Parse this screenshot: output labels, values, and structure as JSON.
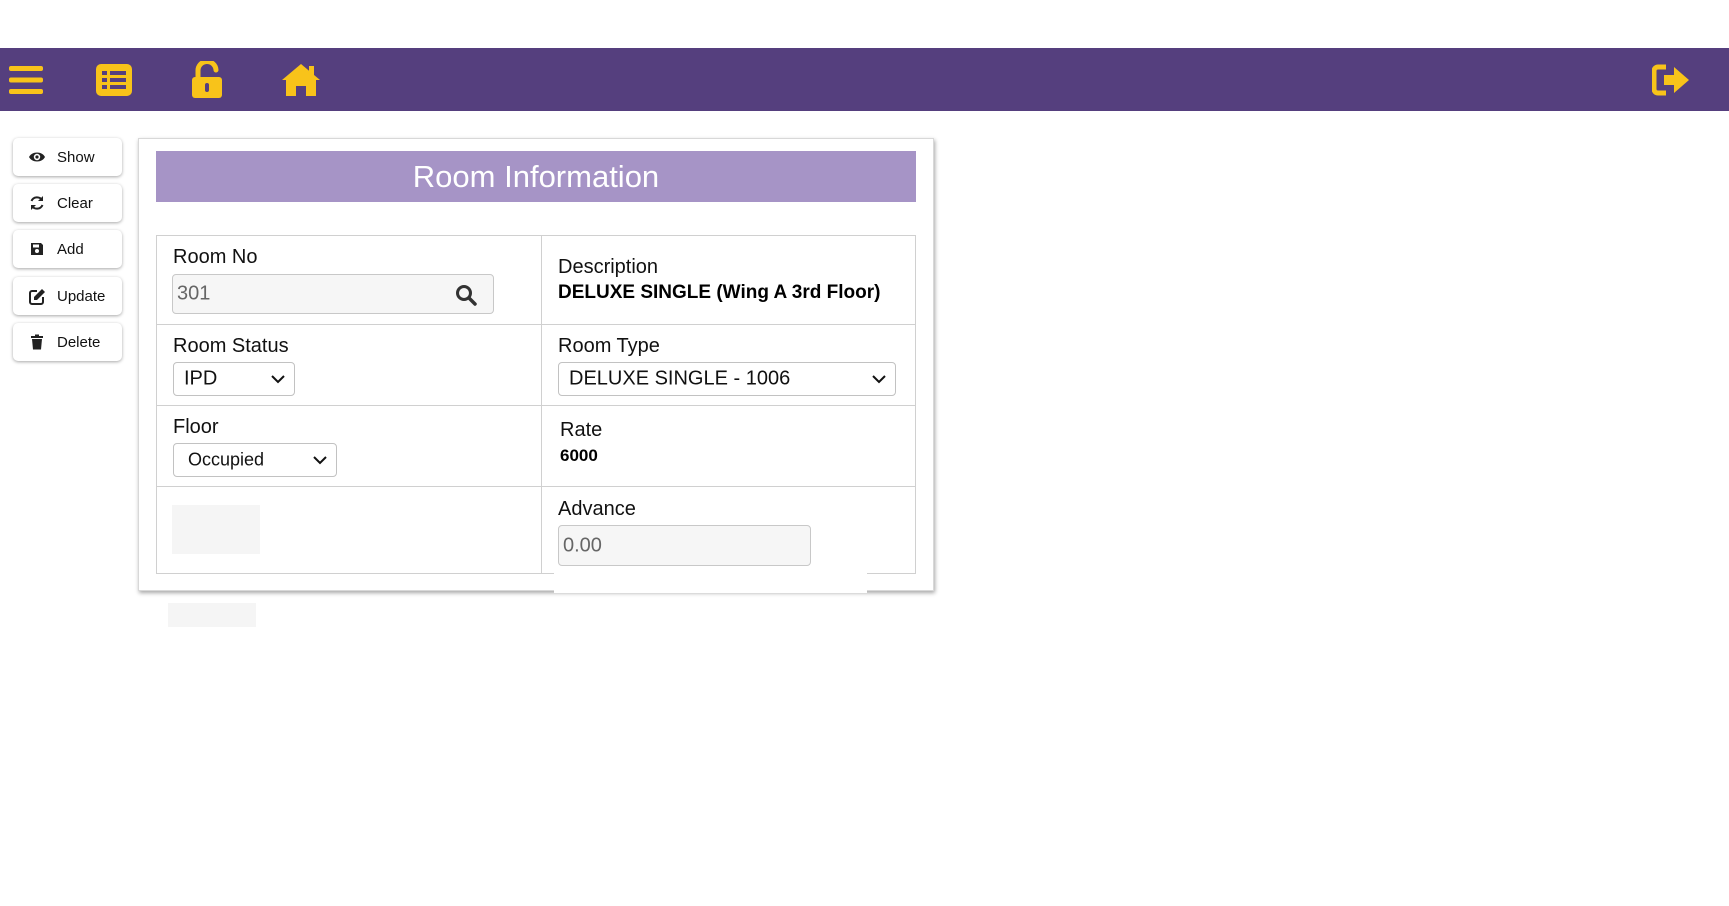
{
  "topbar": {
    "icons": [
      "menu-icon",
      "list-icon",
      "unlock-icon",
      "home-icon",
      "logout-icon"
    ],
    "bg_color": "#553f7e",
    "icon_color": "#f8c31a"
  },
  "actions": [
    {
      "label": "Show",
      "icon": "eye-icon"
    },
    {
      "label": "Clear",
      "icon": "refresh-icon"
    },
    {
      "label": "Add",
      "icon": "save-icon"
    },
    {
      "label": "Update",
      "icon": "edit-icon"
    },
    {
      "label": "Delete",
      "icon": "trash-icon"
    }
  ],
  "form": {
    "title": "Room Information",
    "header_color": "#a694c6",
    "room_no": {
      "label": "Room No",
      "value": "301"
    },
    "description": {
      "label": "Description",
      "value": "DELUXE SINGLE (Wing A 3rd Floor)"
    },
    "room_status": {
      "label": "Room Status",
      "value": "IPD"
    },
    "room_type": {
      "label": "Room Type",
      "value": "DELUXE SINGLE - 1006"
    },
    "floor": {
      "label": "Floor",
      "value": "Occupied"
    },
    "rate": {
      "label": "Rate",
      "value": "6000"
    },
    "advance": {
      "label": "Advance",
      "value": "0.00"
    }
  }
}
